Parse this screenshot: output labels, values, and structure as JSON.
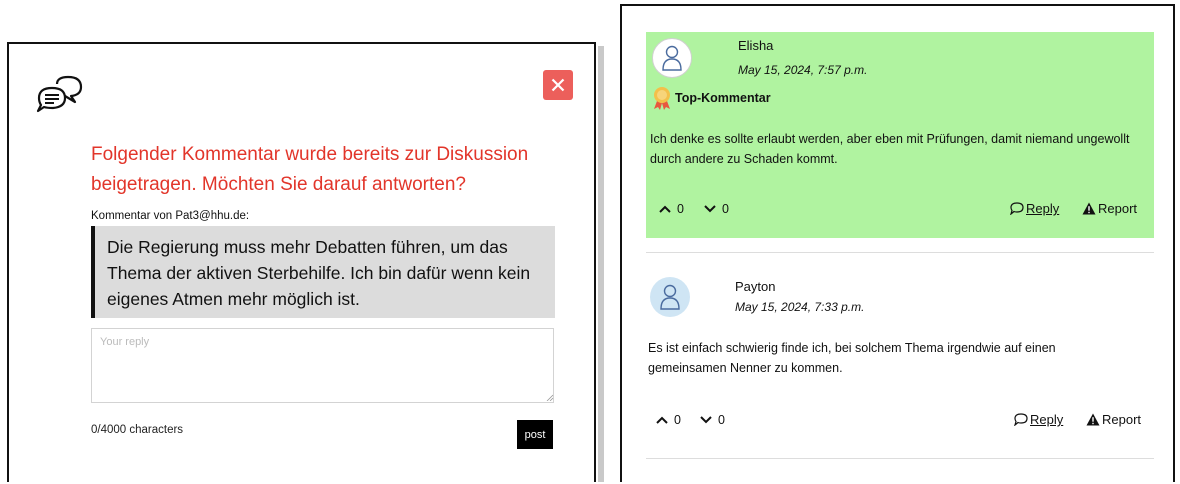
{
  "dialog": {
    "prompt": "Folgender Kommentar wurde bereits zur Diskussion beigetragen. Möchten Sie darauf antworten?",
    "comment_by": "Kommentar von Pat3@hhu.de:",
    "quoted_comment": "Die Regierung muss mehr Debatten führen, um das Thema der aktiven Sterbehilfe. Ich bin dafür wenn kein eigenes Atmen mehr möglich ist.",
    "reply_placeholder": "Your reply",
    "reply_value": "",
    "char_count": "0/4000 characters",
    "post_label": "post",
    "icons": {
      "chat": "chat-bubbles-icon",
      "close": "close-icon"
    },
    "colors": {
      "prompt": "#e2352a",
      "close_bg": "#ec5f5b"
    }
  },
  "comments": [
    {
      "author": "Elisha",
      "date": "May 15, 2024, 7:57 p.m.",
      "badge": "Top-Kommentar",
      "text": "Ich denke es sollte erlaubt werden, aber eben mit Prüfungen, damit niemand ungewollt durch andere zu Schaden kommt.",
      "upvotes": "0",
      "downvotes": "0",
      "reply_label": "Reply",
      "report_label": "Report",
      "highlight_color": "#b0f3a0"
    },
    {
      "author": "Payton",
      "date": "May 15, 2024, 7:33 p.m.",
      "text": "Es ist einfach schwierig finde ich, bei solchem Thema irgendwie auf einen gemeinsamen Nenner zu kommen.",
      "upvotes": "0",
      "downvotes": "0",
      "reply_label": "Reply",
      "report_label": "Report"
    }
  ]
}
